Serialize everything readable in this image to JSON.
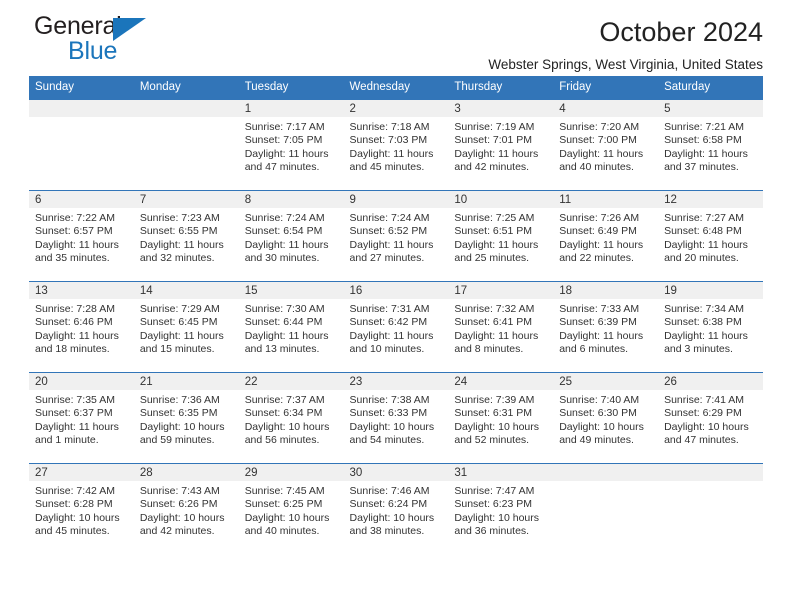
{
  "brand": {
    "name_part1": "General",
    "name_part2": "Blue",
    "accent_color": "#1b75bb"
  },
  "header": {
    "title": "October 2024",
    "location": "Webster Springs, West Virginia, United States",
    "header_bg_color": "#3275b8",
    "band_bg_color": "#f0f0f0"
  },
  "weekday_headers": [
    "Sunday",
    "Monday",
    "Tuesday",
    "Wednesday",
    "Thursday",
    "Friday",
    "Saturday"
  ],
  "labels": {
    "sunrise_prefix": "Sunrise:",
    "sunset_prefix": "Sunset:",
    "daylight_prefix": "Daylight:"
  },
  "weeks": [
    [
      {
        "day": "",
        "sunrise": "",
        "sunset": "",
        "daylight_line1": "",
        "daylight_line2": ""
      },
      {
        "day": "",
        "sunrise": "",
        "sunset": "",
        "daylight_line1": "",
        "daylight_line2": ""
      },
      {
        "day": "1",
        "sunrise": "Sunrise: 7:17 AM",
        "sunset": "Sunset: 7:05 PM",
        "daylight_line1": "Daylight: 11 hours",
        "daylight_line2": "and 47 minutes."
      },
      {
        "day": "2",
        "sunrise": "Sunrise: 7:18 AM",
        "sunset": "Sunset: 7:03 PM",
        "daylight_line1": "Daylight: 11 hours",
        "daylight_line2": "and 45 minutes."
      },
      {
        "day": "3",
        "sunrise": "Sunrise: 7:19 AM",
        "sunset": "Sunset: 7:01 PM",
        "daylight_line1": "Daylight: 11 hours",
        "daylight_line2": "and 42 minutes."
      },
      {
        "day": "4",
        "sunrise": "Sunrise: 7:20 AM",
        "sunset": "Sunset: 7:00 PM",
        "daylight_line1": "Daylight: 11 hours",
        "daylight_line2": "and 40 minutes."
      },
      {
        "day": "5",
        "sunrise": "Sunrise: 7:21 AM",
        "sunset": "Sunset: 6:58 PM",
        "daylight_line1": "Daylight: 11 hours",
        "daylight_line2": "and 37 minutes."
      }
    ],
    [
      {
        "day": "6",
        "sunrise": "Sunrise: 7:22 AM",
        "sunset": "Sunset: 6:57 PM",
        "daylight_line1": "Daylight: 11 hours",
        "daylight_line2": "and 35 minutes."
      },
      {
        "day": "7",
        "sunrise": "Sunrise: 7:23 AM",
        "sunset": "Sunset: 6:55 PM",
        "daylight_line1": "Daylight: 11 hours",
        "daylight_line2": "and 32 minutes."
      },
      {
        "day": "8",
        "sunrise": "Sunrise: 7:24 AM",
        "sunset": "Sunset: 6:54 PM",
        "daylight_line1": "Daylight: 11 hours",
        "daylight_line2": "and 30 minutes."
      },
      {
        "day": "9",
        "sunrise": "Sunrise: 7:24 AM",
        "sunset": "Sunset: 6:52 PM",
        "daylight_line1": "Daylight: 11 hours",
        "daylight_line2": "and 27 minutes."
      },
      {
        "day": "10",
        "sunrise": "Sunrise: 7:25 AM",
        "sunset": "Sunset: 6:51 PM",
        "daylight_line1": "Daylight: 11 hours",
        "daylight_line2": "and 25 minutes."
      },
      {
        "day": "11",
        "sunrise": "Sunrise: 7:26 AM",
        "sunset": "Sunset: 6:49 PM",
        "daylight_line1": "Daylight: 11 hours",
        "daylight_line2": "and 22 minutes."
      },
      {
        "day": "12",
        "sunrise": "Sunrise: 7:27 AM",
        "sunset": "Sunset: 6:48 PM",
        "daylight_line1": "Daylight: 11 hours",
        "daylight_line2": "and 20 minutes."
      }
    ],
    [
      {
        "day": "13",
        "sunrise": "Sunrise: 7:28 AM",
        "sunset": "Sunset: 6:46 PM",
        "daylight_line1": "Daylight: 11 hours",
        "daylight_line2": "and 18 minutes."
      },
      {
        "day": "14",
        "sunrise": "Sunrise: 7:29 AM",
        "sunset": "Sunset: 6:45 PM",
        "daylight_line1": "Daylight: 11 hours",
        "daylight_line2": "and 15 minutes."
      },
      {
        "day": "15",
        "sunrise": "Sunrise: 7:30 AM",
        "sunset": "Sunset: 6:44 PM",
        "daylight_line1": "Daylight: 11 hours",
        "daylight_line2": "and 13 minutes."
      },
      {
        "day": "16",
        "sunrise": "Sunrise: 7:31 AM",
        "sunset": "Sunset: 6:42 PM",
        "daylight_line1": "Daylight: 11 hours",
        "daylight_line2": "and 10 minutes."
      },
      {
        "day": "17",
        "sunrise": "Sunrise: 7:32 AM",
        "sunset": "Sunset: 6:41 PM",
        "daylight_line1": "Daylight: 11 hours",
        "daylight_line2": "and 8 minutes."
      },
      {
        "day": "18",
        "sunrise": "Sunrise: 7:33 AM",
        "sunset": "Sunset: 6:39 PM",
        "daylight_line1": "Daylight: 11 hours",
        "daylight_line2": "and 6 minutes."
      },
      {
        "day": "19",
        "sunrise": "Sunrise: 7:34 AM",
        "sunset": "Sunset: 6:38 PM",
        "daylight_line1": "Daylight: 11 hours",
        "daylight_line2": "and 3 minutes."
      }
    ],
    [
      {
        "day": "20",
        "sunrise": "Sunrise: 7:35 AM",
        "sunset": "Sunset: 6:37 PM",
        "daylight_line1": "Daylight: 11 hours",
        "daylight_line2": "and 1 minute."
      },
      {
        "day": "21",
        "sunrise": "Sunrise: 7:36 AM",
        "sunset": "Sunset: 6:35 PM",
        "daylight_line1": "Daylight: 10 hours",
        "daylight_line2": "and 59 minutes."
      },
      {
        "day": "22",
        "sunrise": "Sunrise: 7:37 AM",
        "sunset": "Sunset: 6:34 PM",
        "daylight_line1": "Daylight: 10 hours",
        "daylight_line2": "and 56 minutes."
      },
      {
        "day": "23",
        "sunrise": "Sunrise: 7:38 AM",
        "sunset": "Sunset: 6:33 PM",
        "daylight_line1": "Daylight: 10 hours",
        "daylight_line2": "and 54 minutes."
      },
      {
        "day": "24",
        "sunrise": "Sunrise: 7:39 AM",
        "sunset": "Sunset: 6:31 PM",
        "daylight_line1": "Daylight: 10 hours",
        "daylight_line2": "and 52 minutes."
      },
      {
        "day": "25",
        "sunrise": "Sunrise: 7:40 AM",
        "sunset": "Sunset: 6:30 PM",
        "daylight_line1": "Daylight: 10 hours",
        "daylight_line2": "and 49 minutes."
      },
      {
        "day": "26",
        "sunrise": "Sunrise: 7:41 AM",
        "sunset": "Sunset: 6:29 PM",
        "daylight_line1": "Daylight: 10 hours",
        "daylight_line2": "and 47 minutes."
      }
    ],
    [
      {
        "day": "27",
        "sunrise": "Sunrise: 7:42 AM",
        "sunset": "Sunset: 6:28 PM",
        "daylight_line1": "Daylight: 10 hours",
        "daylight_line2": "and 45 minutes."
      },
      {
        "day": "28",
        "sunrise": "Sunrise: 7:43 AM",
        "sunset": "Sunset: 6:26 PM",
        "daylight_line1": "Daylight: 10 hours",
        "daylight_line2": "and 42 minutes."
      },
      {
        "day": "29",
        "sunrise": "Sunrise: 7:45 AM",
        "sunset": "Sunset: 6:25 PM",
        "daylight_line1": "Daylight: 10 hours",
        "daylight_line2": "and 40 minutes."
      },
      {
        "day": "30",
        "sunrise": "Sunrise: 7:46 AM",
        "sunset": "Sunset: 6:24 PM",
        "daylight_line1": "Daylight: 10 hours",
        "daylight_line2": "and 38 minutes."
      },
      {
        "day": "31",
        "sunrise": "Sunrise: 7:47 AM",
        "sunset": "Sunset: 6:23 PM",
        "daylight_line1": "Daylight: 10 hours",
        "daylight_line2": "and 36 minutes."
      },
      {
        "day": "",
        "sunrise": "",
        "sunset": "",
        "daylight_line1": "",
        "daylight_line2": ""
      },
      {
        "day": "",
        "sunrise": "",
        "sunset": "",
        "daylight_line1": "",
        "daylight_line2": ""
      }
    ]
  ]
}
